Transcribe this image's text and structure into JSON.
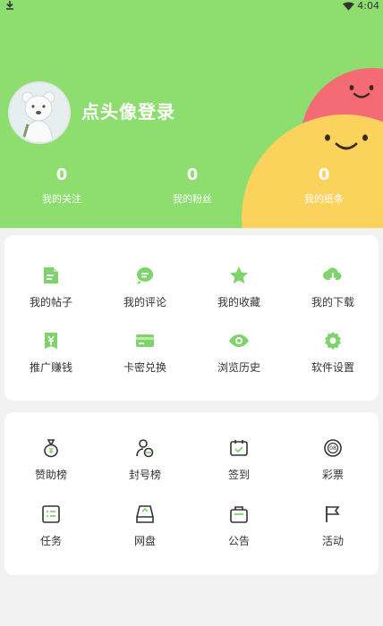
{
  "status_bar": {
    "time": "4:04"
  },
  "header": {
    "login_prompt": "点头像登录"
  },
  "stats": [
    {
      "value": "0",
      "label": "我的关注"
    },
    {
      "value": "0",
      "label": "我的粉丝"
    },
    {
      "value": "0",
      "label": "我的纸条"
    }
  ],
  "menu1": [
    {
      "label": "我的帖子",
      "icon": "post-icon"
    },
    {
      "label": "我的评论",
      "icon": "comment-icon"
    },
    {
      "label": "我的收藏",
      "icon": "star-icon"
    },
    {
      "label": "我的下载",
      "icon": "cloud-download-icon"
    },
    {
      "label": "推广赚钱",
      "icon": "promote-icon"
    },
    {
      "label": "卡密兑换",
      "icon": "card-icon"
    },
    {
      "label": "浏览历史",
      "icon": "eye-icon"
    },
    {
      "label": "软件设置",
      "icon": "gear-icon"
    }
  ],
  "menu2": [
    {
      "label": "赞助榜",
      "icon": "money-bag-icon"
    },
    {
      "label": "封号榜",
      "icon": "user-ban-icon"
    },
    {
      "label": "签到",
      "icon": "calendar-check-icon"
    },
    {
      "label": "彩票",
      "icon": "lottery-ball-icon"
    },
    {
      "label": "任务",
      "icon": "task-icon"
    },
    {
      "label": "网盘",
      "icon": "disk-icon"
    },
    {
      "label": "公告",
      "icon": "notice-icon"
    },
    {
      "label": "活动",
      "icon": "flag-icon"
    }
  ],
  "colors": {
    "header_green": "#8edd6f",
    "icon_green": "#7ed36b",
    "blob_pink": "#f46b76",
    "blob_yellow": "#fbd25c"
  }
}
